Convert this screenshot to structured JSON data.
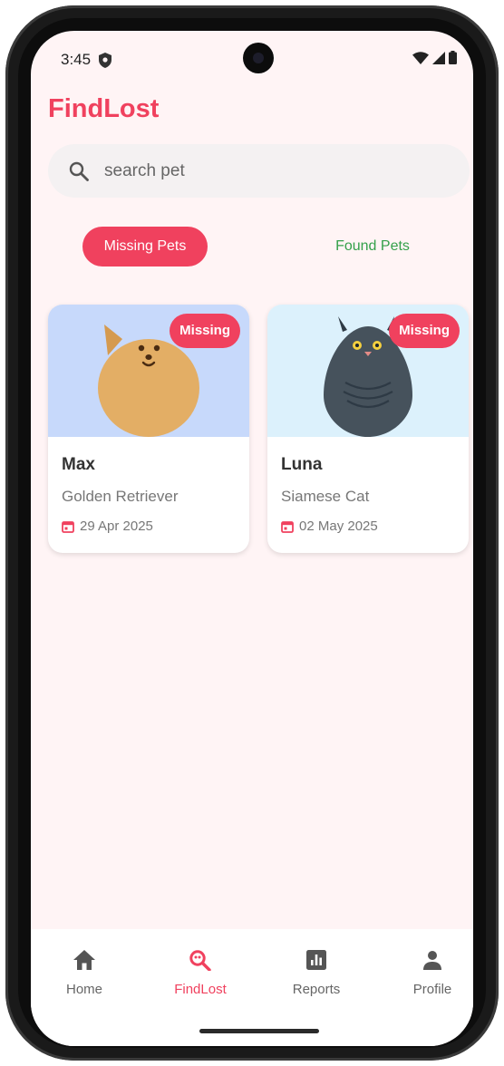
{
  "status_bar": {
    "time": "3:45"
  },
  "app": {
    "title": "FindLost",
    "accent_color": "#F0415E",
    "found_color": "#34A04A"
  },
  "search": {
    "placeholder": "search pet",
    "value": ""
  },
  "tabs": [
    {
      "label": "Missing Pets",
      "active": true
    },
    {
      "label": "Found Pets",
      "active": false
    }
  ],
  "pets": [
    {
      "name": "Max",
      "breed": "Golden Retriever",
      "date": "29 Apr 2025",
      "status": "Missing",
      "image": "dog-illustration",
      "image_bg": "#C7D9FB"
    },
    {
      "name": "Luna",
      "breed": "Siamese Cat",
      "date": "02 May 2025",
      "status": "Missing",
      "image": "cat-illustration",
      "image_bg": "#DCF1FC"
    }
  ],
  "bottom_nav": [
    {
      "label": "Home",
      "icon": "home-icon",
      "active": false
    },
    {
      "label": "FindLost",
      "icon": "find-lost-icon",
      "active": true
    },
    {
      "label": "Reports",
      "icon": "reports-icon",
      "active": false
    },
    {
      "label": "Profile",
      "icon": "profile-icon",
      "active": false
    }
  ]
}
